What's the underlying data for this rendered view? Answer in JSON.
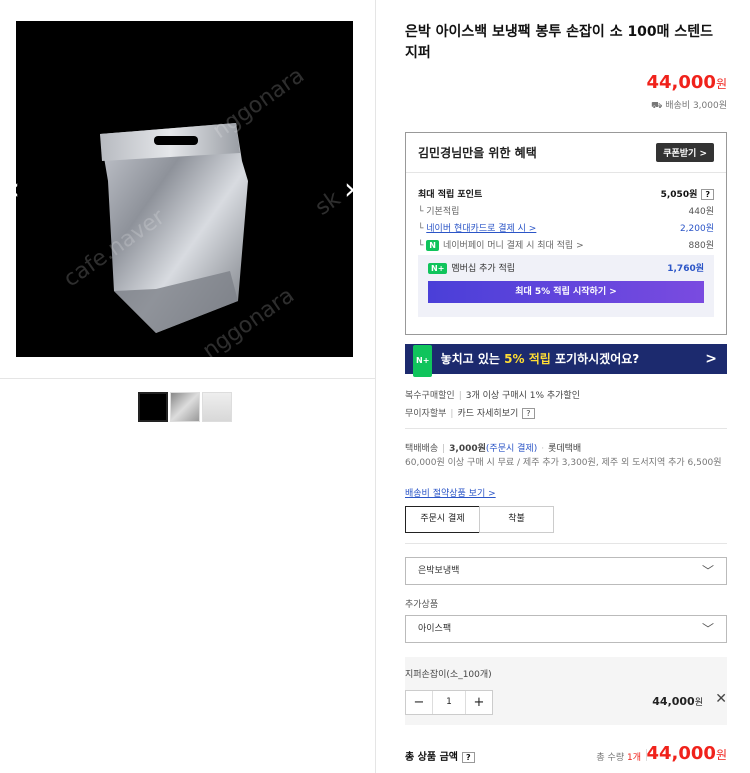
{
  "gallery": {
    "prev_icon": "chevron-left-icon",
    "next_icon": "chevron-right-icon",
    "watermark": [
      "cafe.naver",
      "nggonara",
      "nggonara",
      "cafe.n",
      "sk"
    ]
  },
  "product": {
    "title": "은박 아이스백 보냉팩 봉투 손잡이 소 100매 스텐드 지퍼",
    "price": "44,000",
    "price_unit": "원",
    "shipping_summary": "배송비 3,000원"
  },
  "benefit": {
    "heading": "김민경님만을 위한 혜택",
    "coupon_button": "쿠폰받기 >",
    "max_points_label": "최대 적립 포인트",
    "max_points_value": "5,050원",
    "q": "?",
    "rows": [
      {
        "label": "기본적립",
        "value": "440원"
      },
      {
        "label": "네이버 현대카드로 결제 시 >",
        "value": "2,200원"
      },
      {
        "label": "네이버페이 머니 결제 시 최대 적립 >",
        "value": "880원"
      }
    ],
    "member_badge": "N+",
    "member_label": "멤버십 추가 적립",
    "member_value": "1,760원",
    "member_button": "최대 5% 적립 시작하기 >"
  },
  "banner": {
    "badge": "N+",
    "text_a": "놓치고 있는",
    "text_hl": "5% 적립",
    "text_b": "포기하시겠어요?",
    "chev": ">"
  },
  "extras": {
    "bulk_label": "복수구매할인",
    "bulk_value": "3개 이상 구매시 1% 추가할인",
    "installment_label": "무이자할부",
    "installment_value": "카드 자세히보기"
  },
  "delivery": {
    "label": "택배배송",
    "fee": "3,000원",
    "fee_note": "(주문시 결제)",
    "carrier": "롯데택배",
    "note": "60,000원 이상 구매 시 무료 / 제주 추가 3,300원, 제주 외 도서지역 추가 6,500원",
    "link": "배송비 절약상품 보기 >",
    "tabs": [
      "주문시 결제",
      "착불"
    ]
  },
  "options": {
    "select1": "은박보냉백",
    "addon_label": "추가상품",
    "select2": "아이스팩",
    "selected_name": "지퍼손잡이(소_100개)",
    "qty": "1",
    "selected_price": "44,000",
    "price_unit": "원"
  },
  "total": {
    "label": "총 상품 금액",
    "qty_label": "총 수량",
    "qty_value": "1개",
    "price": "44,000",
    "price_unit": "원"
  }
}
